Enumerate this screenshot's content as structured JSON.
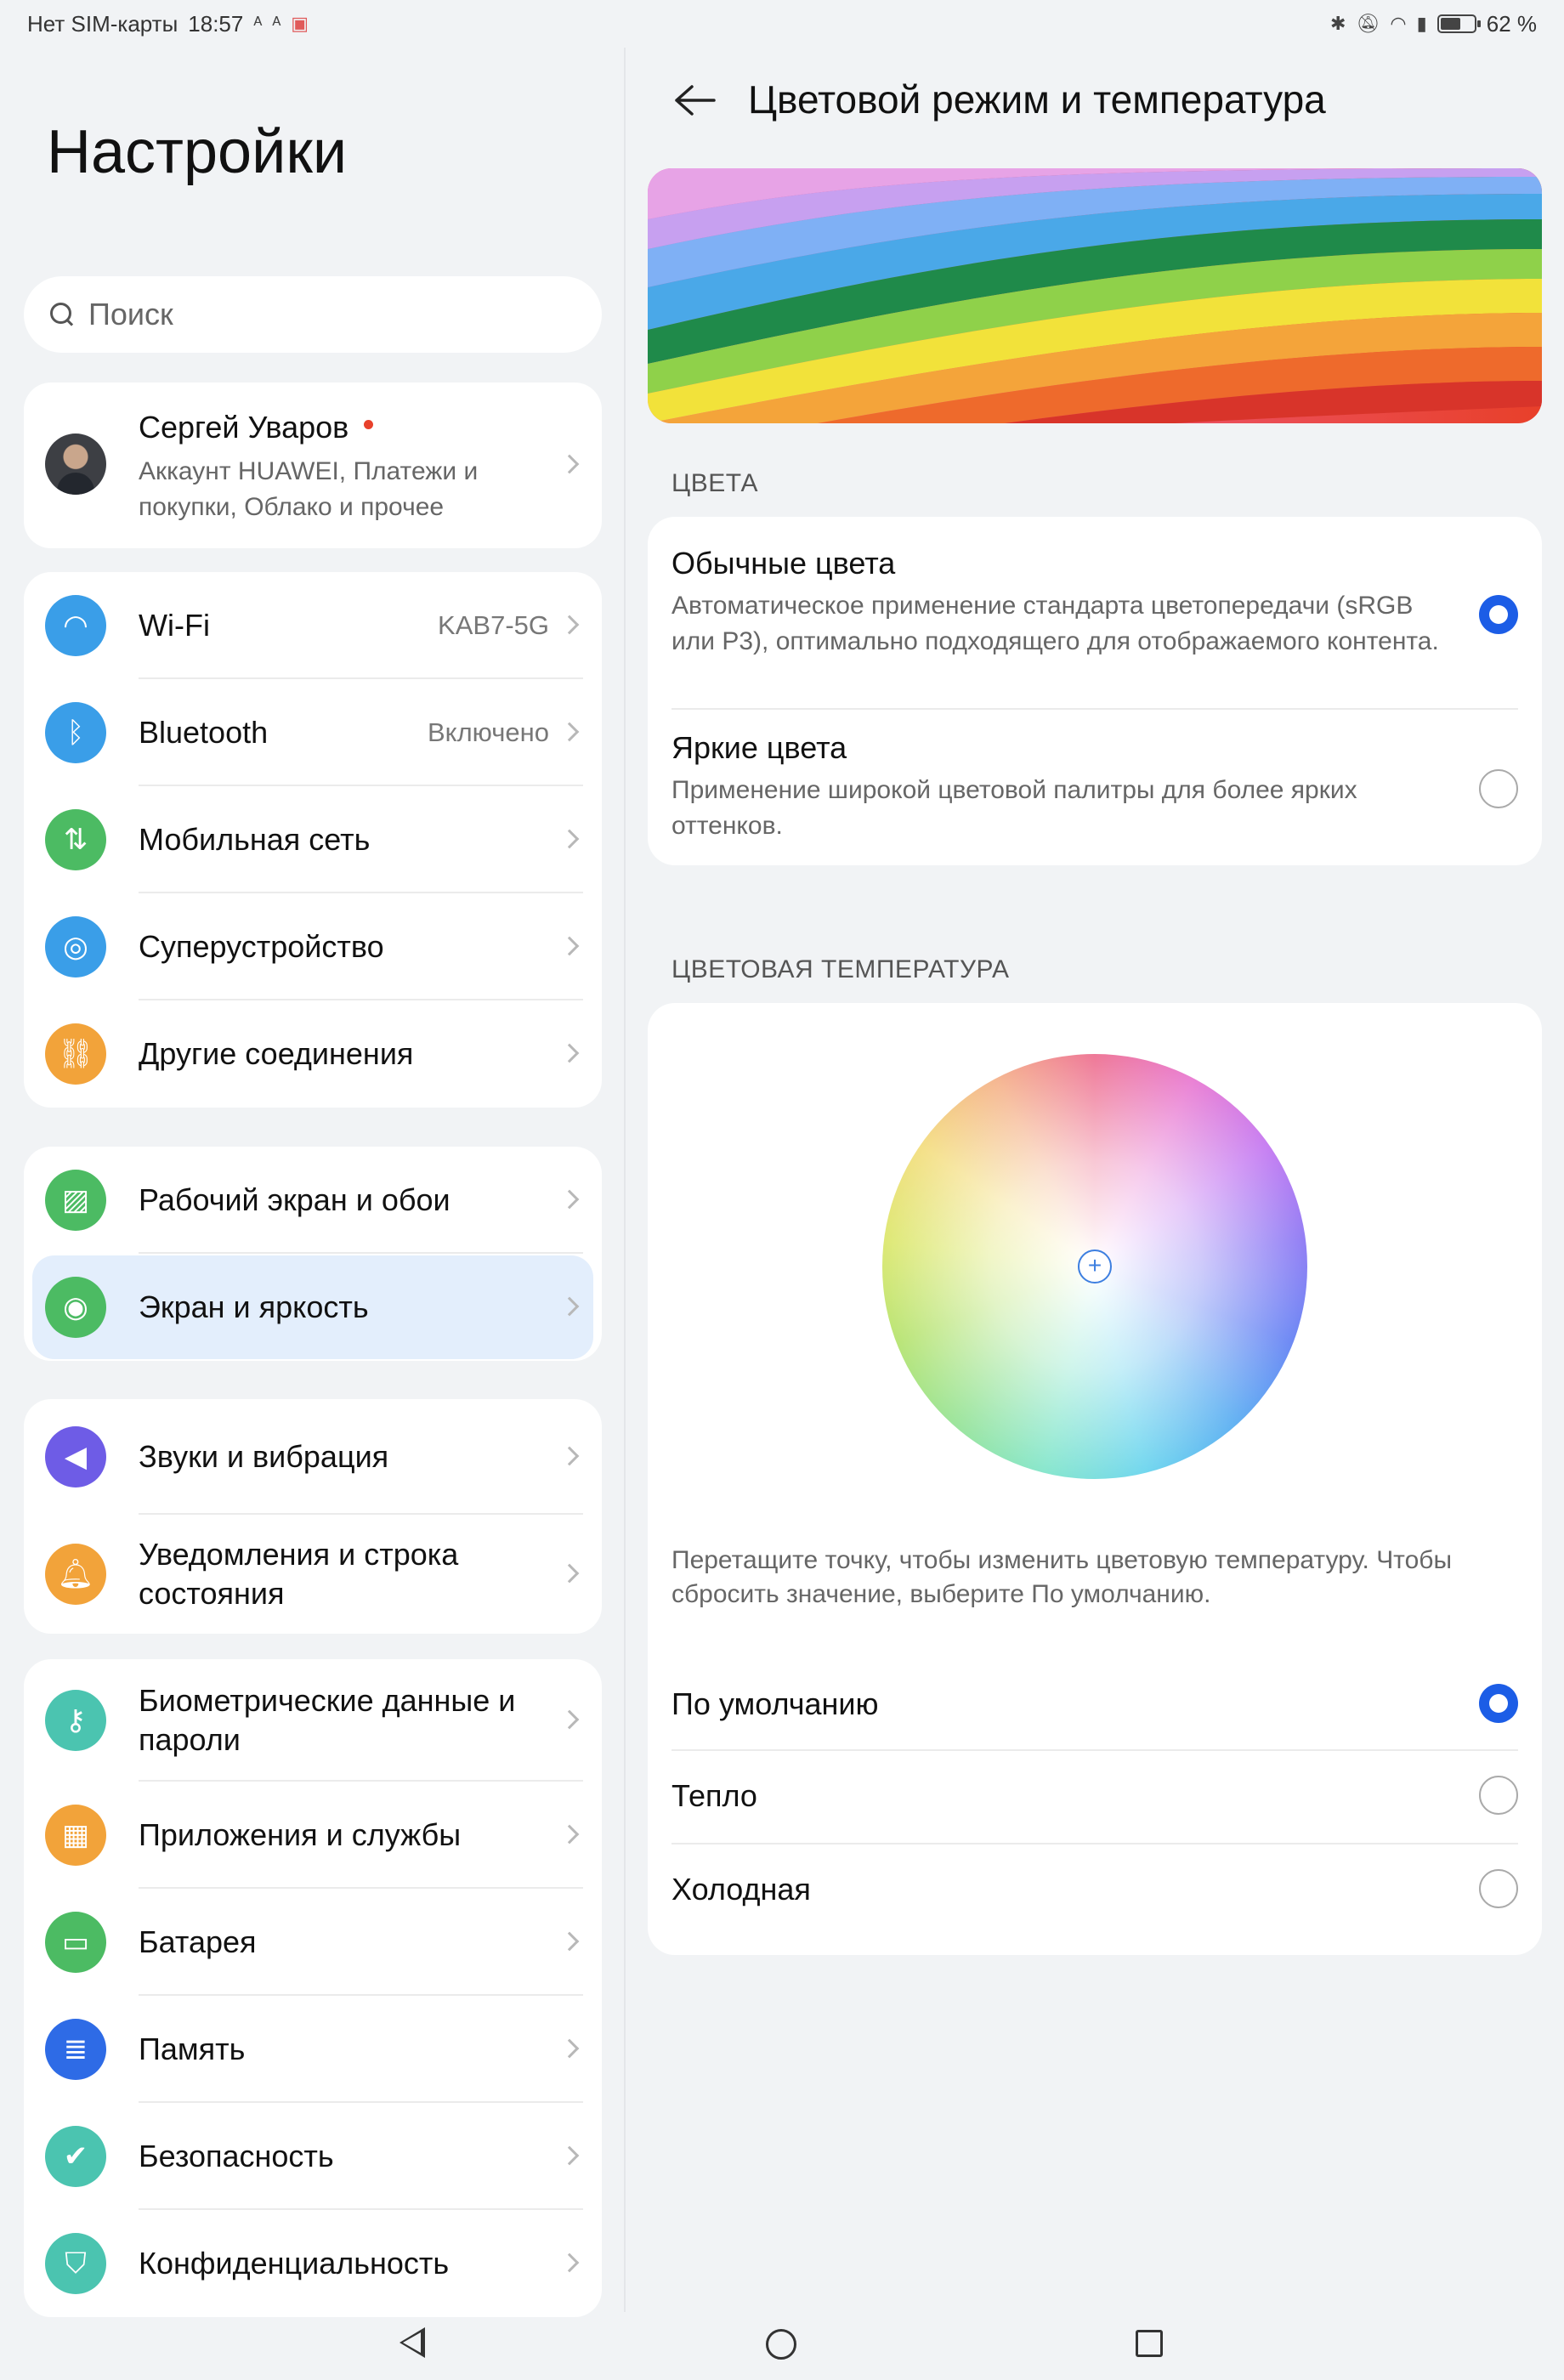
{
  "status_bar": {
    "carrier": "Нет SIM-карты",
    "time": "18:57",
    "battery_percent": "62 %",
    "battery_level": 0.62
  },
  "left_pane": {
    "title": "Настройки",
    "search_placeholder": "Поиск",
    "account": {
      "name": "Сергей Уваров",
      "subtitle": "Аккаунт HUAWEI, Платежи и покупки, Облако и прочее"
    },
    "groups": [
      [
        {
          "label": "Wi-Fi",
          "value": "KAB7-5G",
          "icon": "wifi-icon",
          "color": "#3a9ee8"
        },
        {
          "label": "Bluetooth",
          "value": "Включено",
          "icon": "bluetooth-icon",
          "color": "#3a9ee8"
        },
        {
          "label": "Мобильная сеть",
          "value": "",
          "icon": "mobile-network-icon",
          "color": "#4cbb63"
        },
        {
          "label": "Суперустройство",
          "value": "",
          "icon": "super-device-icon",
          "color": "#3a9ee8"
        },
        {
          "label": "Другие соединения",
          "value": "",
          "icon": "link-icon",
          "color": "#f2a33a"
        }
      ],
      [
        {
          "label": "Рабочий экран и обои",
          "value": "",
          "icon": "wallpaper-icon",
          "color": "#4cbb63"
        },
        {
          "label": "Экран и яркость",
          "value": "",
          "icon": "eye-icon",
          "color": "#4cbb63",
          "selected": true
        }
      ],
      [
        {
          "label": "Звуки и вибрация",
          "value": "",
          "icon": "sound-icon",
          "color": "#6e5ce6"
        },
        {
          "label": "Уведомления и строка состояния",
          "value": "",
          "icon": "bell-icon",
          "color": "#f2a33a"
        }
      ],
      [
        {
          "label": "Биометрические данные и пароли",
          "value": "",
          "icon": "key-icon",
          "color": "#4bc4b0"
        },
        {
          "label": "Приложения и службы",
          "value": "",
          "icon": "apps-icon",
          "color": "#f2a33a"
        },
        {
          "label": "Батарея",
          "value": "",
          "icon": "battery-icon",
          "color": "#4cbb63"
        },
        {
          "label": "Память",
          "value": "",
          "icon": "storage-icon",
          "color": "#2e6be6"
        },
        {
          "label": "Безопасность",
          "value": "",
          "icon": "shield-icon",
          "color": "#4bc4b0"
        },
        {
          "label": "Конфиденциальность",
          "value": "",
          "icon": "privacy-icon",
          "color": "#4bc4b0"
        }
      ]
    ]
  },
  "right_pane": {
    "title": "Цветовой режим и температура",
    "colors_section": "ЦВЕТА",
    "color_options": [
      {
        "title": "Обычные цвета",
        "desc": "Автоматическое применение стандарта цветопередачи (sRGB или P3), оптимально подходящего для отображаемого контента.",
        "selected": true
      },
      {
        "title": "Яркие цвета",
        "desc": "Применение широкой цветовой палитры для более ярких оттенков.",
        "selected": false
      }
    ],
    "temperature_section": "ЦВЕТОВАЯ ТЕМПЕРАТУРА",
    "temperature_help": "Перетащите точку, чтобы изменить цветовую температуру. Чтобы сбросить значение, выберите По умолчанию.",
    "temperature_options": [
      {
        "label": "По умолчанию",
        "selected": true
      },
      {
        "label": "Тепло",
        "selected": false
      },
      {
        "label": "Холодная",
        "selected": false
      }
    ]
  },
  "accent_color": "#1c5de6"
}
